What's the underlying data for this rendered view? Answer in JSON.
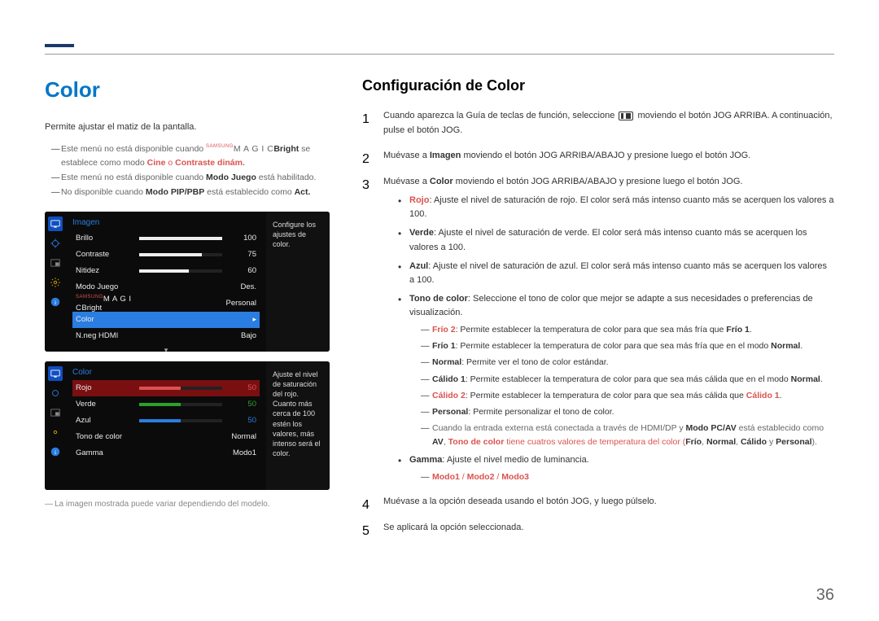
{
  "page_number": "36",
  "left": {
    "heading": "Color",
    "intro": "Permite ajustar el matiz de la pantalla.",
    "notes": {
      "n1_prefix": "Este menú no está disponible cuando ",
      "n1_magic_small": "SAMSUNG",
      "n1_magic": "M A G I C",
      "n1_bright": "Bright",
      "n1_mid": " se establece como modo ",
      "n1_cine": "Cine",
      "n1_o": " o ",
      "n1_cd": "Contraste dinám.",
      "n2_prefix": "Este menú no está disponible cuando ",
      "n2_mj": "Modo Juego",
      "n2_suffix": " está habilitado.",
      "n3_prefix": "No disponible cuando ",
      "n3_pip": "Modo PIP/PBP",
      "n3_mid": " está establecido como ",
      "n3_act": "Act."
    },
    "footer_note": "La imagen mostrada puede variar dependiendo del modelo."
  },
  "osd1": {
    "title": "Imagen",
    "tip": "Configure los ajustes de color.",
    "rows": {
      "brillo": {
        "label": "Brillo",
        "val": "100",
        "pct": 100
      },
      "contraste": {
        "label": "Contraste",
        "val": "75",
        "pct": 75
      },
      "nitidez": {
        "label": "Nitidez",
        "val": "60",
        "pct": 60
      },
      "modojuego": {
        "label": "Modo Juego",
        "right": "Des."
      },
      "magic": {
        "label_small": "SAMSUNG",
        "label_magic": "M A G I C",
        "label_bright": "Bright",
        "right": "Personal"
      },
      "color": {
        "label": "Color"
      },
      "nneg": {
        "label": "N.neg HDMI",
        "right": "Bajo"
      }
    }
  },
  "osd2": {
    "title": "Color",
    "tip": "Ajuste el nivel de saturación del rojo. Cuanto más cerca de 100 estén los valores, más intenso será el color.",
    "rows": {
      "rojo": {
        "label": "Rojo",
        "val": "50",
        "pct": 50,
        "fill": "#d9534f",
        "valcolor": "#d9534f"
      },
      "verde": {
        "label": "Verde",
        "val": "50",
        "pct": 50,
        "fill": "#2aa12a",
        "valcolor": "#2aa12a"
      },
      "azul": {
        "label": "Azul",
        "val": "50",
        "pct": 50,
        "fill": "#2a7de1",
        "valcolor": "#2a7de1"
      },
      "tono": {
        "label": "Tono de color",
        "right": "Normal"
      },
      "gamma": {
        "label": "Gamma",
        "right": "Modo1"
      }
    }
  },
  "right": {
    "heading": "Configuración de Color",
    "step1_a": "Cuando aparezca la Guía de teclas de función, seleccione ",
    "step1_b": " moviendo el botón JOG ARRIBA. A continuación, pulse el botón JOG.",
    "step2_a": "Muévase a ",
    "step2_imagen": "Imagen",
    "step2_b": " moviendo el botón JOG ARRIBA/ABAJO y presione luego el botón JOG.",
    "step3_a": "Muévase a ",
    "step3_color": "Color",
    "step3_b": " moviendo el botón JOG ARRIBA/ABAJO y presione luego el botón JOG.",
    "bullets": {
      "rojo": {
        "k": "Rojo",
        "t": ": Ajuste el nivel de saturación de rojo. El color será más intenso cuanto más se acerquen los valores a 100."
      },
      "verde": {
        "k": "Verde",
        "t": ": Ajuste el nivel de saturación de verde. El color será más intenso cuanto más se acerquen los valores a 100."
      },
      "azul": {
        "k": "Azul",
        "t": ": Ajuste el nivel de saturación de azul. El color será más intenso cuanto más se acerquen los valores a 100."
      },
      "tono": {
        "k": "Tono de color",
        "t": ": Seleccione el tono de color que mejor se adapte a sus necesidades o preferencias de visualización."
      },
      "gamma": {
        "k": "Gamma",
        "t": ": Ajuste el nivel medio de luminancia."
      }
    },
    "tono_sub": {
      "frio2": {
        "k": "Frío 2",
        "t": ": Permite establecer la temperatura de color para que sea más fría que ",
        "tail": "Frío 1",
        "dot": "."
      },
      "frio1": {
        "k": "Frío 1",
        "t": ": Permite establecer la temperatura de color para que sea más fría que en el modo ",
        "tail": "Normal",
        "dot": "."
      },
      "normal": {
        "k": "Normal",
        "t": ": Permite ver el tono de color estándar."
      },
      "calido1": {
        "k": "Cálido 1",
        "t": ": Permite establecer la temperatura de color para que sea más cálida que en el modo ",
        "tail": "Normal",
        "dot": "."
      },
      "calido2": {
        "k": "Cálido 2",
        "t": ": Permite establecer la temperatura de color para que sea más cálida que ",
        "tail": "Cálido 1",
        "dot": "."
      },
      "personal": {
        "k": "Personal",
        "t": ": Permite personalizar el tono de color."
      },
      "ext_a": "Cuando la entrada externa está conectada a través de HDMI/DP y ",
      "ext_mpcav": "Modo PC/AV",
      "ext_b": " está establecido como ",
      "ext_av": "AV",
      "ext_c": ", ",
      "ext_tdc": "Tono de color",
      "ext_d": " tiene cuatros valores de temperatura del color (",
      "ext_frio": "Frío",
      "ext_sep1": ", ",
      "ext_normal": "Normal",
      "ext_sep2": ", ",
      "ext_calido": "Cálido",
      "ext_y": " y ",
      "ext_personal": "Personal",
      "ext_close": ")."
    },
    "gamma_sub": {
      "m1": "Modo1",
      "s1": " / ",
      "m2": "Modo2",
      "s2": " / ",
      "m3": "Modo3"
    },
    "step4": "Muévase a la opción deseada usando el botón JOG, y luego púlselo.",
    "step5": "Se aplicará la opción seleccionada."
  }
}
